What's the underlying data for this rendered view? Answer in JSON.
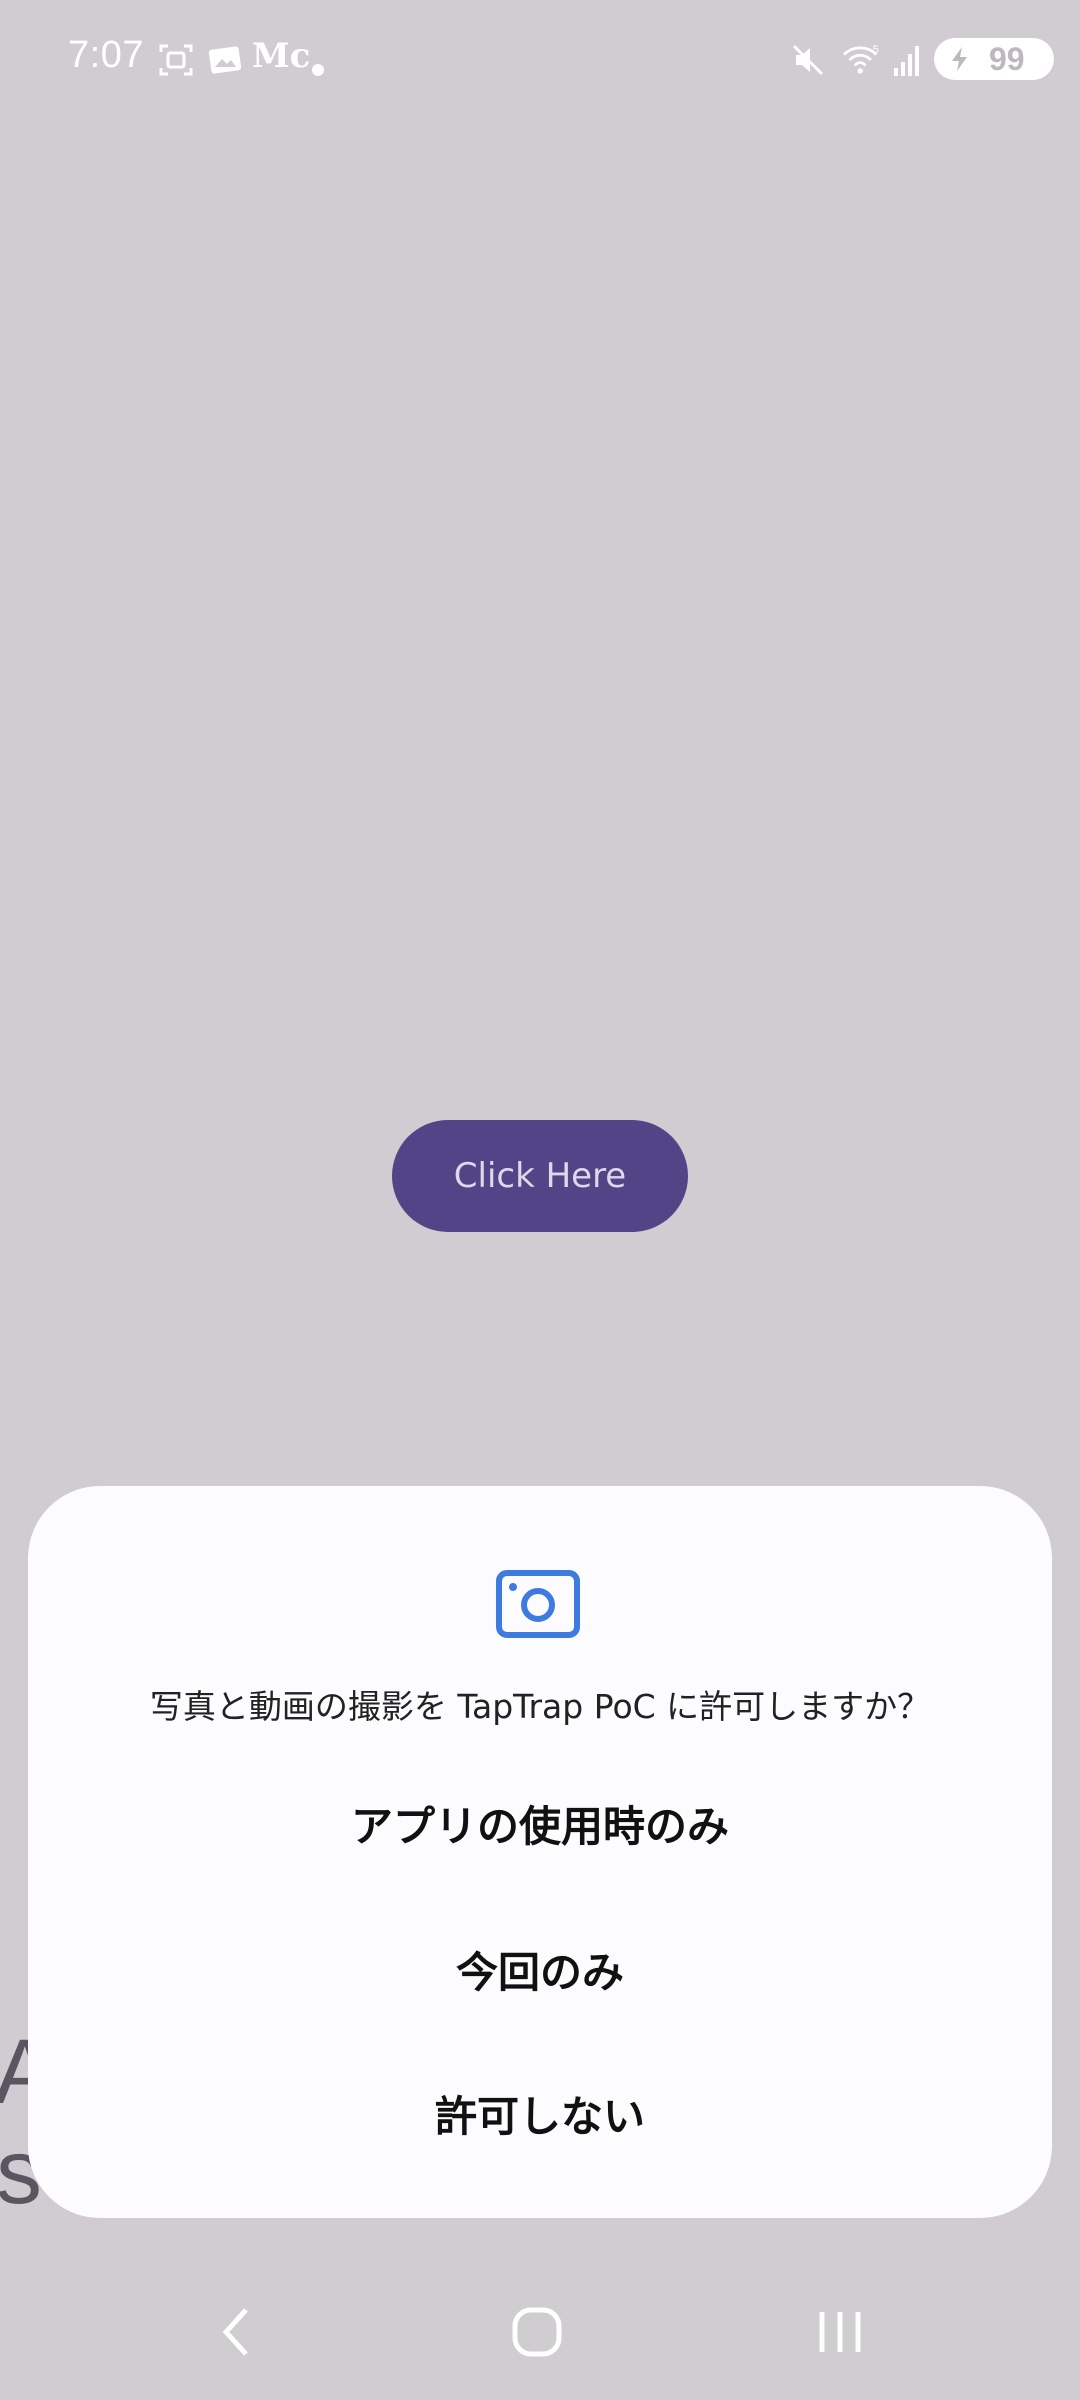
{
  "status_bar": {
    "time": "7:07",
    "notification_text_icon": "Mc",
    "battery_level": "99",
    "icons": [
      "screenshot-icon",
      "gallery-icon",
      "mc-app-icon",
      "dot-icon",
      "mute-icon",
      "wifi-icon",
      "signal-icon",
      "battery-charging-icon"
    ]
  },
  "main": {
    "button_label": "Click Here",
    "background_text_line1": "A",
    "background_text_line2": "sc"
  },
  "dialog": {
    "icon": "camera-icon",
    "message": "写真と動画の撮影を TapTrap PoC に許可しますか？",
    "options": [
      {
        "label": "アプリの使用時のみ"
      },
      {
        "label": "今回のみ"
      },
      {
        "label": "許可しない"
      }
    ]
  },
  "nav_bar": {
    "buttons": [
      "back-icon",
      "home-icon",
      "recents-icon"
    ]
  },
  "colors": {
    "background": "#d1ccd2",
    "button": "#524486",
    "dialog": "#fcfbfe",
    "camera_icon": "#3d7be0",
    "nav_bar": "#cfcdcf"
  }
}
